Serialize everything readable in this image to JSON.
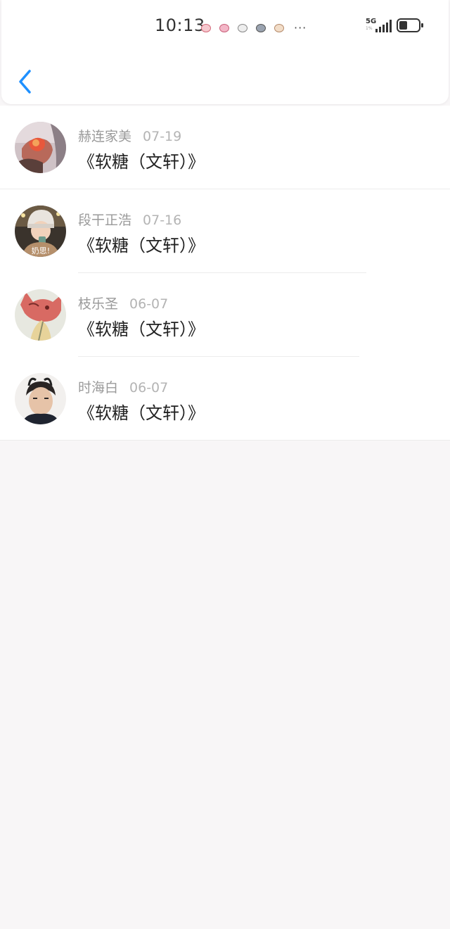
{
  "status_bar": {
    "time": "10:13",
    "network": "5G",
    "network_sub": "1%",
    "more": "···",
    "battery_level": 0.45,
    "notification_icons": [
      "pig-icon-pink",
      "pig-icon-pink",
      "pig-icon-gray",
      "pig-icon-dark",
      "pig-icon-beige"
    ]
  },
  "header": {
    "back_icon": "chevron-left-icon",
    "accent_color": "#1e90ff"
  },
  "items": [
    {
      "name": "赫连家美",
      "date": "07-19",
      "title": "《软糖（文轩）》",
      "avatar": "avatar-hand-peach"
    },
    {
      "name": "段干正浩",
      "date": "07-16",
      "title": "《软糖（文轩）》",
      "avatar": "avatar-hat-boy",
      "avatar_caption": "奶思!"
    },
    {
      "name": "枝乐圣",
      "date": "06-07",
      "title": "《软糖（文轩）》",
      "avatar": "avatar-fox"
    },
    {
      "name": "时海白",
      "date": "06-07",
      "title": "《软糖（文轩）》",
      "avatar": "avatar-man-portrait"
    }
  ]
}
